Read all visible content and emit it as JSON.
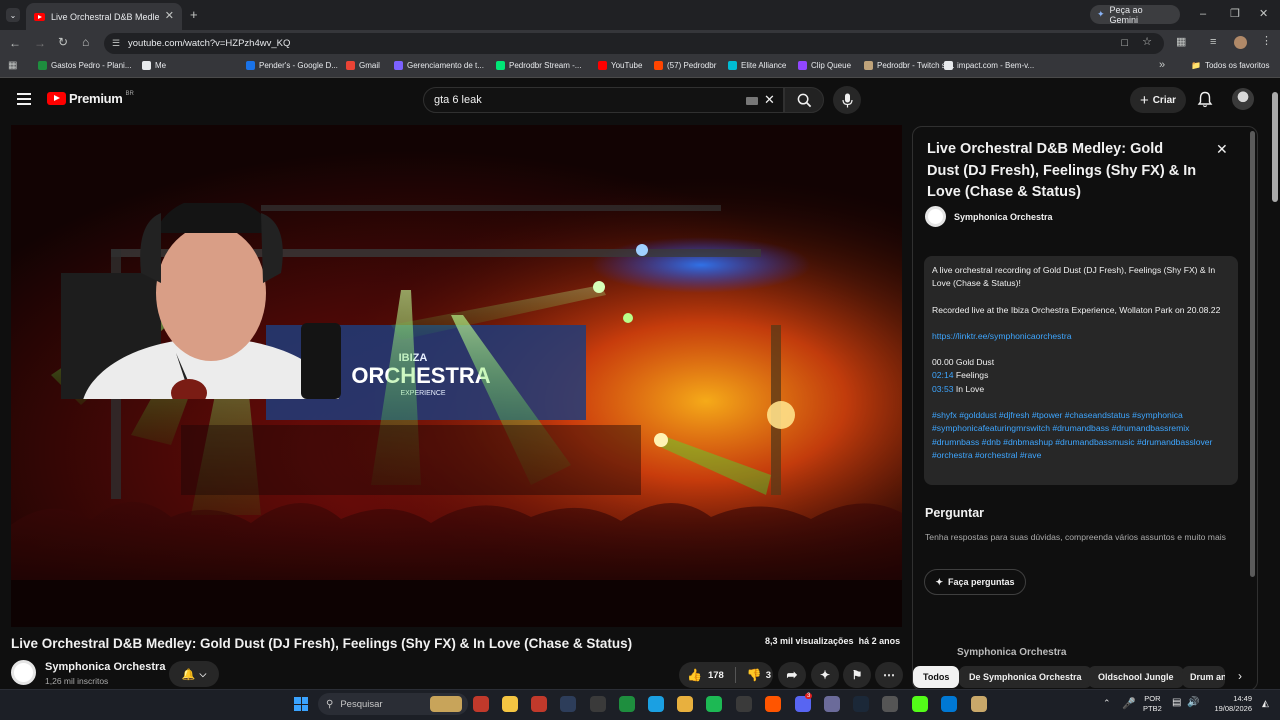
{
  "browser": {
    "tab_title": "Live Orchestral D&B Medley: Gold",
    "gemini_label": "Peça ao Gemini",
    "url": "youtube.com/watch?v=HZPzh4wv_KQ",
    "bookmarks": [
      {
        "label": "Gastos Pedro - Plani...",
        "color": "#1e8e3e"
      },
      {
        "label": "Me",
        "color": "#e8eaed"
      },
      {
        "label": "Pender's - Google D...",
        "color": "#1a73e8"
      },
      {
        "label": "Gmail",
        "color": "#ea4335"
      },
      {
        "label": "Gerenciamento de t...",
        "color": "#7b61ff"
      },
      {
        "label": "Pedrodbr Stream -...",
        "color": "#00e676"
      },
      {
        "label": "YouTube",
        "color": "#ff0000"
      },
      {
        "label": "(57) Pedrodbr",
        "color": "#ff4500"
      },
      {
        "label": "Elite Alliance",
        "color": "#00bcd4"
      },
      {
        "label": "Clip Queue",
        "color": "#9146ff"
      },
      {
        "label": "Pedrodbr - Twitch st...",
        "color": "#bfa37a"
      },
      {
        "label": "impact.com - Bem-v...",
        "color": "#e8eaed"
      }
    ],
    "all_favorites": "Todos os favoritos"
  },
  "youtube": {
    "logo_text": "Premium",
    "logo_region": "BR",
    "search_value": "gta 6 leak",
    "create_label": "Criar"
  },
  "video": {
    "title": "Live Orchestral D&B Medley: Gold Dust (DJ Fresh), Feelings (Shy FX) & In Love (Chase & Status)",
    "views": "8,3 mil visualizações",
    "age": "há 2 anos",
    "channel_name": "Symphonica Orchestra",
    "subscribers": "1,26 mil inscritos",
    "likes": "178",
    "dislikes": "3",
    "banner_line1": "IBIZA",
    "banner_line2": "ORCHESTRA",
    "banner_line3": "EXPERIENCE"
  },
  "panel": {
    "title": "Live Orchestral D&B Medley: Gold Dust (DJ Fresh), Feelings (Shy FX) & In Love (Chase & Status)",
    "channel": "Symphonica Orchestra",
    "description": {
      "intro": "A live orchestral recording of Gold Dust (DJ Fresh), Feelings (Shy FX) & In Love (Chase & Status)!",
      "recorded": "Recorded live at the Ibiza Orchestra Experience, Wollaton Park on 20.08.22",
      "link": "https://linktr.ee/symphonicaorchestra",
      "track1": "00.00 Gold Dust",
      "track2_time": "02:14",
      "track2_name": "Feelings",
      "track3_time": "03:53",
      "track3_name": "In Love",
      "hashtags": "#shyfx #golddust #djfresh #tpower #chaseandstatus #symphonica #symphonicafeaturingmrswitch #drumandbass #drumandbassremix #drumnbass #dnb #dnbmashup #drumandbassmusic #drumandbasslover #orchestra #orchestral #rave"
    },
    "ask_heading": "Perguntar",
    "ask_text": "Tenha respostas para suas dúvidas, compreenda vários assuntos e muito mais",
    "ask_button": "Faça perguntas",
    "cut_channel": "Symphonica Orchestra"
  },
  "chips": [
    "Todos",
    "De Symphonica Orchestra",
    "Oldschool Jungle",
    "Drum an"
  ],
  "taskbar": {
    "search_label": "Pesquisar",
    "lang_top": "POR",
    "lang_bottom": "PTB2",
    "time": "14:49",
    "date": "19/08/2026",
    "badge_count": "3"
  }
}
